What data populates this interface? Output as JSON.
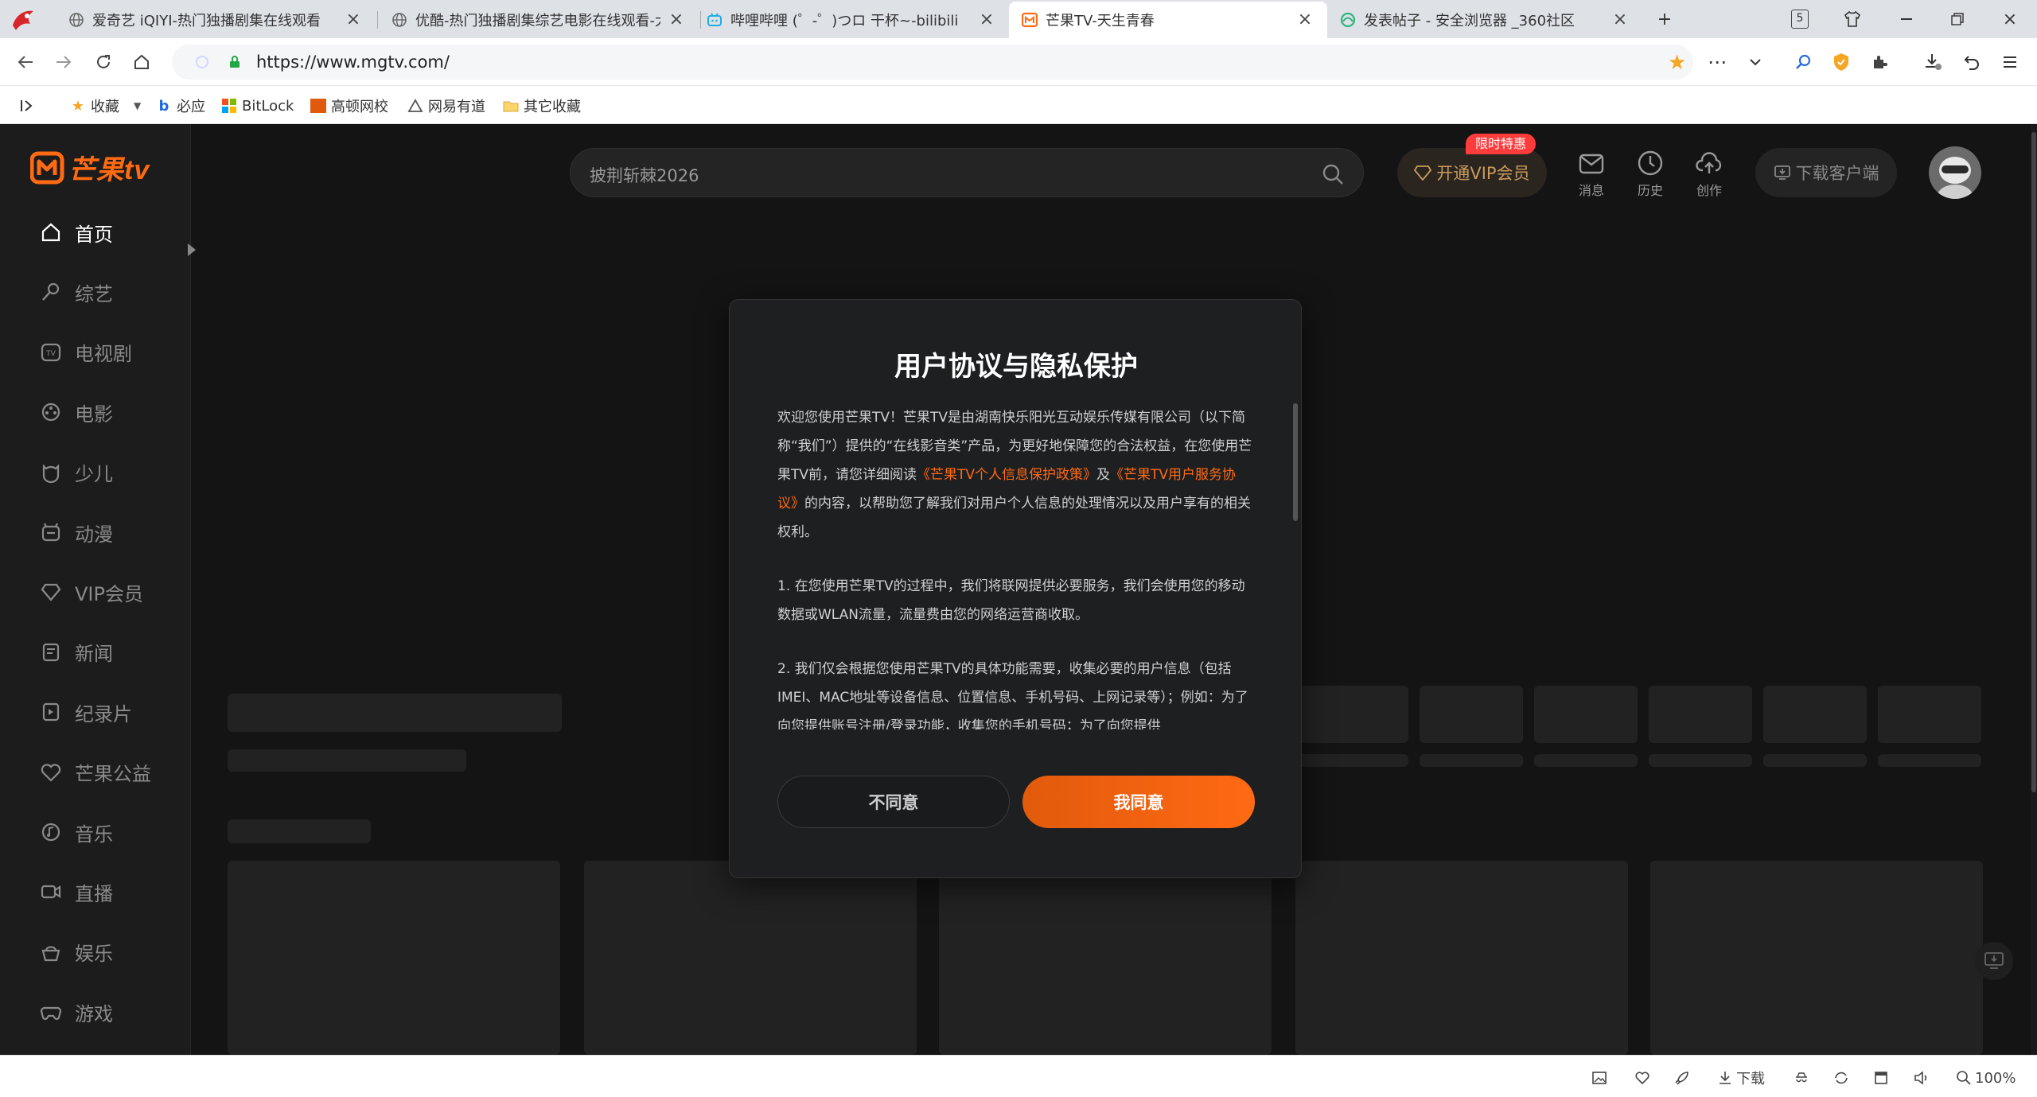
{
  "browser": {
    "tabs": [
      {
        "title": "爱奇艺 iQIYI-热门独播剧集在线观看",
        "active": false
      },
      {
        "title": "优酷-热门独播剧集综艺电影在线观看-大",
        "active": false
      },
      {
        "title": "哔哩哔哩 (゜-゜)つロ 干杯~-bilibili",
        "active": false
      },
      {
        "title": "芒果TV-天生青春",
        "active": true
      },
      {
        "title": "发表帖子 - 安全浏览器 _360社区",
        "active": false
      }
    ],
    "tab_count": "5",
    "url": "https://www.mgtv.com/",
    "bookmarks": [
      {
        "label": "收藏",
        "icon": "star-icon"
      },
      {
        "label": "必应",
        "icon": "bing-icon"
      },
      {
        "label": "BitLock",
        "icon": "windows-icon"
      },
      {
        "label": "高顿网校",
        "icon": "golden-icon"
      },
      {
        "label": "网易有道",
        "icon": "youdao-icon"
      },
      {
        "label": "其它收藏",
        "icon": "folder-icon"
      }
    ]
  },
  "site": {
    "logo_text": "芒果tv",
    "search_placeholder": "披荆斩棘2026",
    "vip_label": "开通VIP会员",
    "vip_badge": "限时特惠",
    "top_icons": [
      {
        "label": "消息",
        "icon": "message-icon"
      },
      {
        "label": "历史",
        "icon": "history-icon"
      },
      {
        "label": "创作",
        "icon": "upload-icon"
      }
    ],
    "download_label": "下载客户端",
    "sidebar": [
      {
        "label": "首页",
        "icon": "home-icon",
        "active": true
      },
      {
        "label": "综艺",
        "icon": "mic-icon",
        "active": false
      },
      {
        "label": "电视剧",
        "icon": "tv-icon",
        "active": false
      },
      {
        "label": "电影",
        "icon": "film-icon",
        "active": false
      },
      {
        "label": "少儿",
        "icon": "kid-icon",
        "active": false
      },
      {
        "label": "动漫",
        "icon": "anime-icon",
        "active": false
      },
      {
        "label": "VIP会员",
        "icon": "diamond-icon",
        "active": false
      },
      {
        "label": "新闻",
        "icon": "news-icon",
        "active": false
      },
      {
        "label": "纪录片",
        "icon": "doc-icon",
        "active": false
      },
      {
        "label": "芒果公益",
        "icon": "heart-icon",
        "active": false
      },
      {
        "label": "音乐",
        "icon": "music-icon",
        "active": false
      },
      {
        "label": "直播",
        "icon": "live-icon",
        "active": false
      },
      {
        "label": "娱乐",
        "icon": "ent-icon",
        "active": false
      },
      {
        "label": "游戏",
        "icon": "game-icon",
        "active": false
      }
    ]
  },
  "modal": {
    "title": "用户协议与隐私保护",
    "para1_a": "欢迎您使用芒果TV！芒果TV是由湖南快乐阳光互动娱乐传媒有限公司（以下简称“我们”）提供的“在线影音类”产品，为更好地保障您的合法权益，在您使用芒果TV前，请您详细阅读",
    "link_privacy": "《芒果TV个人信息保护政策》",
    "and": "及",
    "link_terms": "《芒果TV用户服务协议》",
    "para1_b": "的内容，以帮助您了解我们对用户个人信息的处理情况以及用户享有的相关权利。",
    "para2": "1. 在您使用芒果TV的过程中，我们将联网提供必要服务，我们会使用您的移动数据或WLAN流量，流量费由您的网络运营商收取。",
    "para3": "2. 我们仅会根据您使用芒果TV的具体功能需要，收集必要的用户信息（包括IMEI、MAC地址等设备信息、位置信息、手机号码、上网记录等）；例如：为了向您提供账号注册/登录功能，收集您的手机号码；为了向您提供",
    "disagree": "不同意",
    "agree": "我同意"
  },
  "status_bar": {
    "download": "下载",
    "zoom": "100%"
  },
  "colors": {
    "accent": "#ff6a13",
    "page_bg": "#141414",
    "modal_bg": "#1e1f21"
  }
}
